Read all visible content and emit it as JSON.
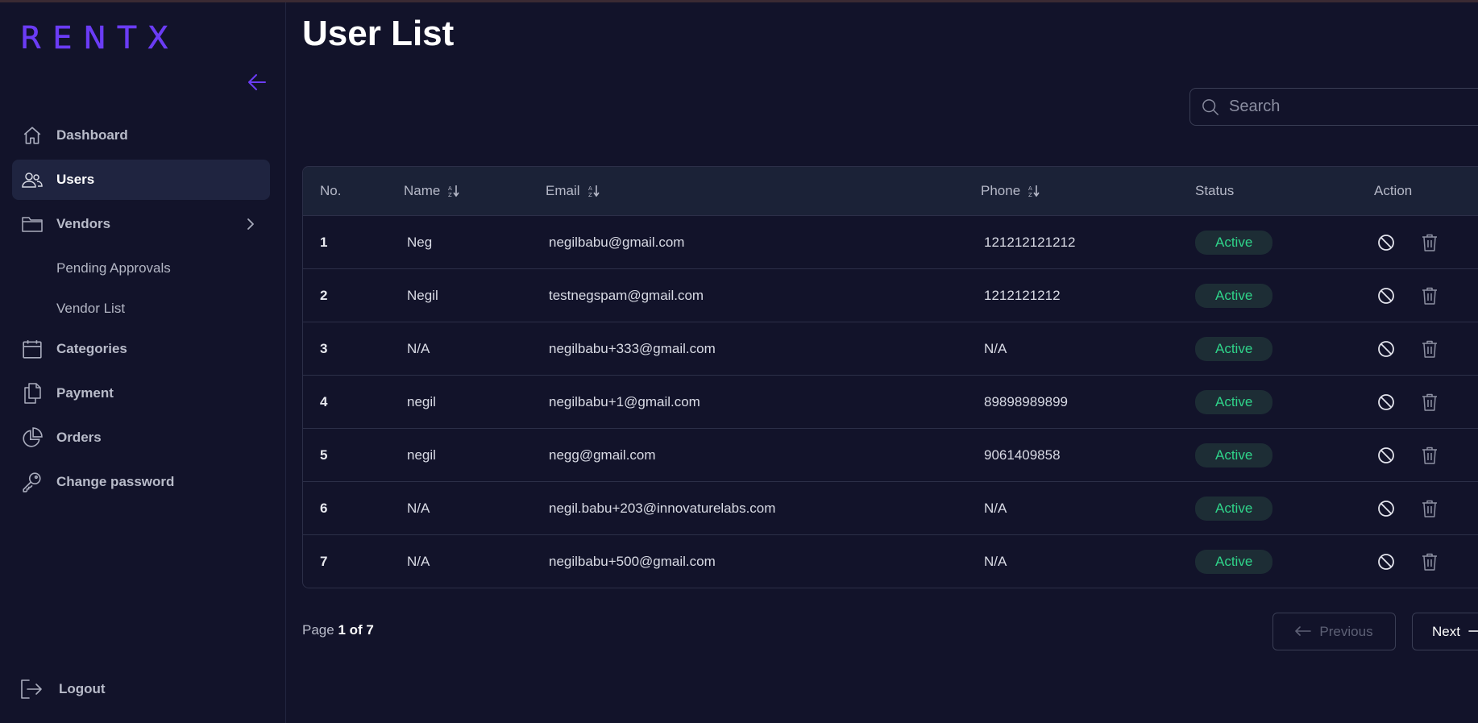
{
  "app": {
    "logo": "RENTX"
  },
  "sidebar": {
    "items": [
      {
        "label": "Dashboard",
        "icon": "home-icon"
      },
      {
        "label": "Users",
        "icon": "users-icon",
        "active": true
      },
      {
        "label": "Vendors",
        "icon": "folder-icon",
        "expanded": true
      },
      {
        "label": "Categories",
        "icon": "calendar-icon"
      },
      {
        "label": "Payment",
        "icon": "documents-icon"
      },
      {
        "label": "Orders",
        "icon": "pie-chart-icon"
      },
      {
        "label": "Change password",
        "icon": "key-icon"
      }
    ],
    "vendor_sub_items": [
      {
        "label": "Pending Approvals"
      },
      {
        "label": "Vendor List"
      }
    ],
    "logout": "Logout"
  },
  "main": {
    "title": "User List",
    "search": {
      "placeholder": "Search",
      "value": ""
    },
    "table": {
      "columns": [
        "No.",
        "Name",
        "Email",
        "Phone",
        "Status",
        "Action"
      ],
      "rows": [
        {
          "no": "1",
          "name": "Neg",
          "email": "negilbabu@gmail.com",
          "phone": "121212121212",
          "status": "Active"
        },
        {
          "no": "2",
          "name": "Negil",
          "email": "testnegspam@gmail.com",
          "phone": "1212121212",
          "status": "Active"
        },
        {
          "no": "3",
          "name": "N/A",
          "email": "negilbabu+333@gmail.com",
          "phone": "N/A",
          "status": "Active"
        },
        {
          "no": "4",
          "name": "negil",
          "email": "negilbabu+1@gmail.com",
          "phone": "89898989899",
          "status": "Active"
        },
        {
          "no": "5",
          "name": "negil",
          "email": "negg@gmail.com",
          "phone": "9061409858",
          "status": "Active"
        },
        {
          "no": "6",
          "name": "N/A",
          "email": "negil.babu+203@innovaturelabs.com",
          "phone": "N/A",
          "status": "Active"
        },
        {
          "no": "7",
          "name": "N/A",
          "email": "negilbabu+500@gmail.com",
          "phone": "N/A",
          "status": "Active"
        }
      ]
    },
    "pagination": {
      "page_label": "Page",
      "current": "1",
      "of_label": "of",
      "total": "7",
      "previous": "Previous",
      "next": "Next"
    }
  },
  "colors": {
    "background": "#12132a",
    "accent": "#6b3cf5",
    "status_active": "#2fd48a",
    "table_header": "#1b2237"
  }
}
